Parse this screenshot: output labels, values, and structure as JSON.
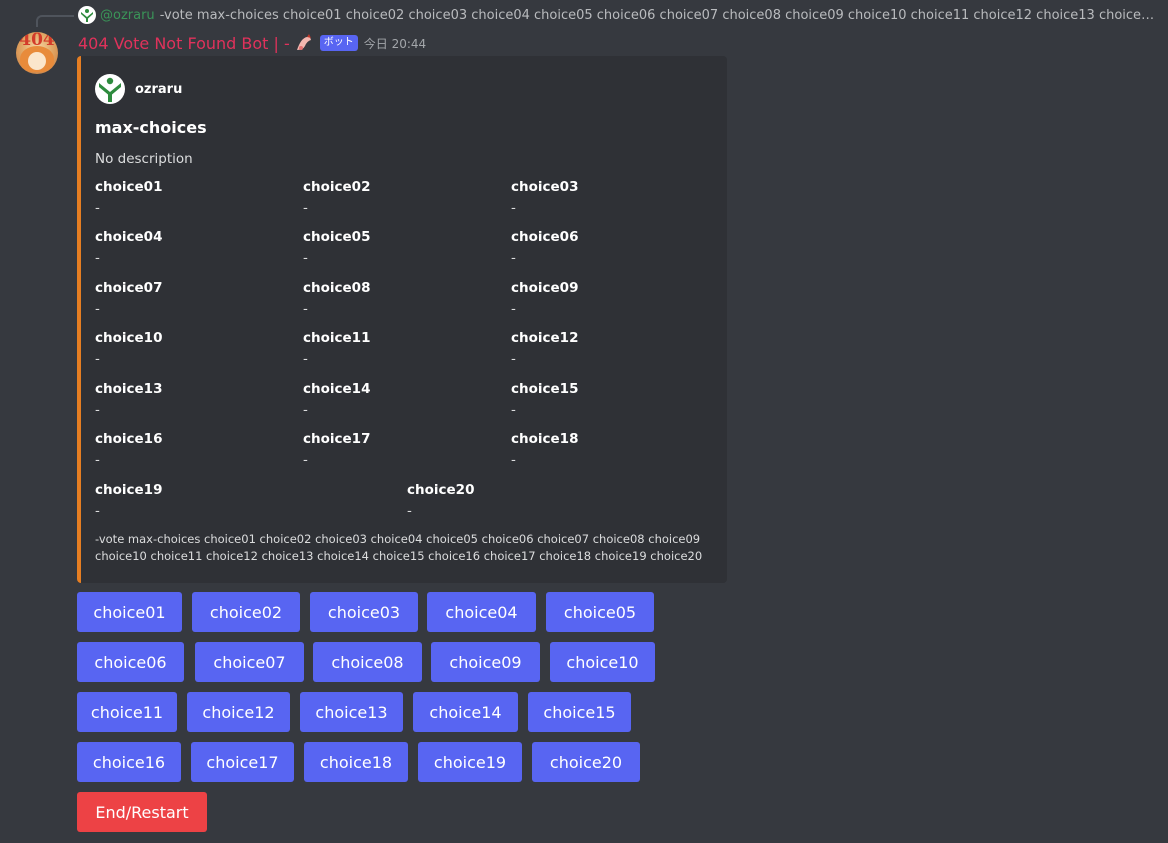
{
  "reply": {
    "username": "@ozraru",
    "text": "-vote max-choices choice01 choice02 choice03 choice04 choice05 choice06 choice07 choice08 choice09 choice10 choice11 choice12 choice13 choice14 ..."
  },
  "message": {
    "avatar_text": "404",
    "bot_name": "404 Vote Not Found Bot | -",
    "bot_tag": "ボット",
    "timestamp": "今日 20:44"
  },
  "embed": {
    "accent_color": "#e67e22",
    "author_name": "ozraru",
    "title": "max-choices",
    "description": "No description",
    "fields": [
      {
        "name": "choice01",
        "value": "-"
      },
      {
        "name": "choice02",
        "value": "-"
      },
      {
        "name": "choice03",
        "value": "-"
      },
      {
        "name": "choice04",
        "value": "-"
      },
      {
        "name": "choice05",
        "value": "-"
      },
      {
        "name": "choice06",
        "value": "-"
      },
      {
        "name": "choice07",
        "value": "-"
      },
      {
        "name": "choice08",
        "value": "-"
      },
      {
        "name": "choice09",
        "value": "-"
      },
      {
        "name": "choice10",
        "value": "-"
      },
      {
        "name": "choice11",
        "value": "-"
      },
      {
        "name": "choice12",
        "value": "-"
      },
      {
        "name": "choice13",
        "value": "-"
      },
      {
        "name": "choice14",
        "value": "-"
      },
      {
        "name": "choice15",
        "value": "-"
      },
      {
        "name": "choice16",
        "value": "-"
      },
      {
        "name": "choice17",
        "value": "-"
      },
      {
        "name": "choice18",
        "value": "-"
      },
      {
        "name": "choice19",
        "value": "-"
      },
      {
        "name": "choice20",
        "value": "-"
      }
    ],
    "footer": "-vote max-choices choice01 choice02 choice03 choice04 choice05 choice06 choice07 choice08 choice09 choice10 choice11 choice12 choice13 choice14 choice15 choice16 choice17 choice18 choice19 choice20"
  },
  "buttons": [
    "choice01",
    "choice02",
    "choice03",
    "choice04",
    "choice05",
    "choice06",
    "choice07",
    "choice08",
    "choice09",
    "choice10",
    "choice11",
    "choice12",
    "choice13",
    "choice14",
    "choice15",
    "choice16",
    "choice17",
    "choice18",
    "choice19",
    "choice20"
  ],
  "end_button": "End/Restart",
  "colors": {
    "background": "#36393f",
    "embed_bg": "#2f3136",
    "blurple": "#5865f2",
    "danger": "#ed4245",
    "bot_name": "#e0325b"
  }
}
